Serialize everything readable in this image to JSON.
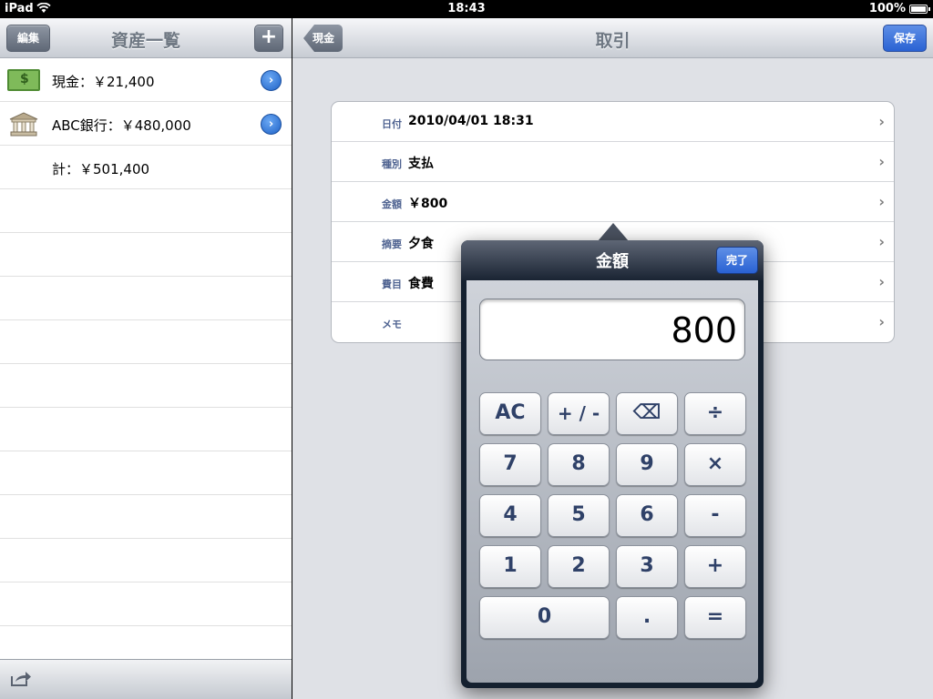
{
  "status": {
    "carrier": "iPad",
    "time": "18:43",
    "battery": "100%"
  },
  "master": {
    "title": "資産一覧",
    "edit_label": "編集",
    "add_label": "+",
    "rows": [
      {
        "label": "現金：￥21,400",
        "icon": "cash-icon"
      },
      {
        "label": "ABC銀行：￥480,000",
        "icon": "bank-icon"
      },
      {
        "label": "計：￥501,400"
      }
    ]
  },
  "detail": {
    "title": "取引",
    "back_label": "現金",
    "save_label": "保存",
    "fields": [
      {
        "key": "日付",
        "value": "2010/04/01 18:31"
      },
      {
        "key": "種別",
        "value": "支払"
      },
      {
        "key": "金額",
        "value": "￥800"
      },
      {
        "key": "摘要",
        "value": "夕食"
      },
      {
        "key": "費目",
        "value": "食費"
      },
      {
        "key": "メモ",
        "value": ""
      }
    ],
    "chevron": "›"
  },
  "popover": {
    "title": "金額",
    "done_label": "完了",
    "display": "800",
    "keys": {
      "ac": "AC",
      "sign": "+ / -",
      "backspace": "⌫",
      "divide": "÷",
      "k7": "7",
      "k8": "8",
      "k9": "9",
      "multiply": "×",
      "k4": "4",
      "k5": "5",
      "k6": "6",
      "minus": "-",
      "k1": "1",
      "k2": "2",
      "k3": "3",
      "plus": "+",
      "k0": "0",
      "dot": ".",
      "equals": "="
    }
  },
  "colors": {
    "accent": "#2a62d3",
    "key_text": "#2f4168",
    "popover_bg": "#14202f"
  }
}
